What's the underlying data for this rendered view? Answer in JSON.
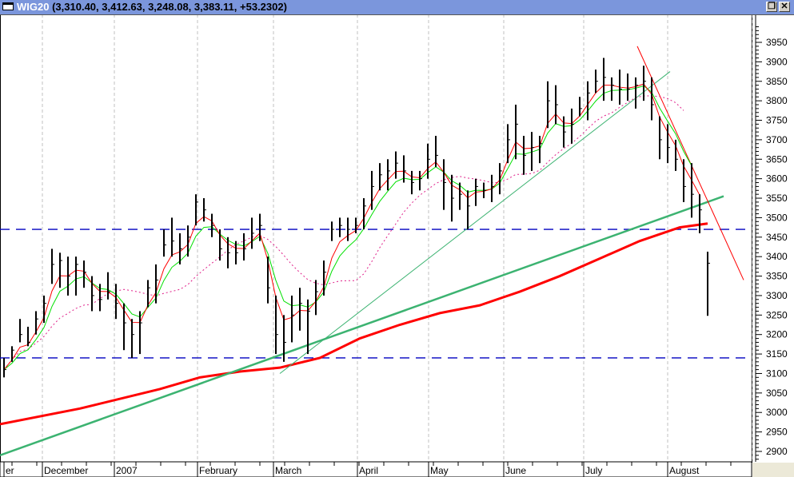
{
  "window": {
    "symbol": "WIG20",
    "values": "(3,310.40, 3,412.63, 3,248.08, 3,383.11, +53.2302)",
    "restore_icon": "restore-icon",
    "close_icon": "close-icon"
  },
  "chart_data": {
    "type": "ohlc-bar",
    "title": "WIG20",
    "ylim": [
      2880,
      3990
    ],
    "y_ticks": [
      2900,
      2950,
      3000,
      3050,
      3100,
      3150,
      3200,
      3250,
      3300,
      3350,
      3400,
      3450,
      3500,
      3550,
      3600,
      3650,
      3700,
      3750,
      3800,
      3850,
      3900,
      3950
    ],
    "x_labels": [
      {
        "label": "er",
        "bar": 0
      },
      {
        "label": "December",
        "bar": 4.8
      },
      {
        "label": "2007",
        "bar": 13.8
      },
      {
        "label": "February",
        "bar": 24.2
      },
      {
        "label": "March",
        "bar": 33.7
      },
      {
        "label": "April",
        "bar": 44.2
      },
      {
        "label": "May",
        "bar": 53.1
      },
      {
        "label": "June",
        "bar": 62.5
      },
      {
        "label": "July",
        "bar": 72.5
      },
      {
        "label": "August",
        "bar": 83
      }
    ],
    "bars": [
      [
        3140,
        3090,
        3110
      ],
      [
        3170,
        3130,
        3160
      ],
      [
        3240,
        3180,
        3200
      ],
      [
        3220,
        3170,
        3180
      ],
      [
        3260,
        3200,
        3240
      ],
      [
        3300,
        3230,
        3280
      ],
      [
        3420,
        3330,
        3380
      ],
      [
        3410,
        3320,
        3390
      ],
      [
        3400,
        3300,
        3350
      ],
      [
        3400,
        3300,
        3380
      ],
      [
        3390,
        3320,
        3360
      ],
      [
        3350,
        3260,
        3300
      ],
      [
        3330,
        3260,
        3290
      ],
      [
        3360,
        3290,
        3310
      ],
      [
        3330,
        3240,
        3280
      ],
      [
        3280,
        3160,
        3230
      ],
      [
        3240,
        3140,
        3200
      ],
      [
        3260,
        3150,
        3230
      ],
      [
        3340,
        3270,
        3320
      ],
      [
        3380,
        3280,
        3340
      ],
      [
        3470,
        3400,
        3430
      ],
      [
        3500,
        3400,
        3440
      ],
      [
        3460,
        3380,
        3420
      ],
      [
        3480,
        3400,
        3450
      ],
      [
        3560,
        3480,
        3540
      ],
      [
        3550,
        3490,
        3520
      ],
      [
        3510,
        3450,
        3480
      ],
      [
        3470,
        3390,
        3420
      ],
      [
        3450,
        3370,
        3410
      ],
      [
        3440,
        3380,
        3410
      ],
      [
        3460,
        3390,
        3420
      ],
      [
        3500,
        3420,
        3460
      ],
      [
        3510,
        3440,
        3480
      ],
      [
        3400,
        3280,
        3320
      ],
      [
        3300,
        3150,
        3200
      ],
      [
        3250,
        3130,
        3180
      ],
      [
        3300,
        3180,
        3250
      ],
      [
        3320,
        3210,
        3280
      ],
      [
        3290,
        3150,
        3260
      ],
      [
        3340,
        3250,
        3310
      ],
      [
        3390,
        3300,
        3360
      ],
      [
        3490,
        3440,
        3470
      ],
      [
        3500,
        3450,
        3480
      ],
      [
        3500,
        3440,
        3470
      ],
      [
        3500,
        3460,
        3480
      ],
      [
        3550,
        3470,
        3530
      ],
      [
        3620,
        3520,
        3580
      ],
      [
        3640,
        3570,
        3610
      ],
      [
        3650,
        3570,
        3620
      ],
      [
        3670,
        3600,
        3640
      ],
      [
        3660,
        3590,
        3620
      ],
      [
        3620,
        3560,
        3590
      ],
      [
        3620,
        3570,
        3600
      ],
      [
        3690,
        3600,
        3650
      ],
      [
        3710,
        3630,
        3660
      ],
      [
        3650,
        3520,
        3590
      ],
      [
        3610,
        3490,
        3550
      ],
      [
        3590,
        3520,
        3560
      ],
      [
        3570,
        3470,
        3530
      ],
      [
        3600,
        3530,
        3580
      ],
      [
        3590,
        3550,
        3570
      ],
      [
        3610,
        3540,
        3580
      ],
      [
        3640,
        3560,
        3620
      ],
      [
        3740,
        3640,
        3700
      ],
      [
        3790,
        3650,
        3740
      ],
      [
        3710,
        3610,
        3660
      ],
      [
        3720,
        3620,
        3680
      ],
      [
        3710,
        3640,
        3690
      ],
      [
        3850,
        3730,
        3800
      ],
      [
        3840,
        3740,
        3790
      ],
      [
        3760,
        3680,
        3720
      ],
      [
        3780,
        3690,
        3740
      ],
      [
        3810,
        3760,
        3780
      ],
      [
        3850,
        3750,
        3820
      ],
      [
        3880,
        3820,
        3850
      ],
      [
        3910,
        3800,
        3860
      ],
      [
        3860,
        3800,
        3840
      ],
      [
        3880,
        3790,
        3830
      ],
      [
        3870,
        3800,
        3830
      ],
      [
        3860,
        3780,
        3840
      ],
      [
        3890,
        3800,
        3850
      ],
      [
        3860,
        3750,
        3790
      ],
      [
        3760,
        3650,
        3700
      ],
      [
        3740,
        3640,
        3680
      ],
      [
        3700,
        3620,
        3650
      ],
      [
        3650,
        3540,
        3580
      ],
      [
        3640,
        3500,
        3560
      ],
      [
        3560,
        3460,
        3520
      ],
      [
        3412.63,
        3248.08,
        3383.11
      ]
    ],
    "bar_fields": [
      "high",
      "low",
      "close"
    ],
    "long_ma": [
      [
        -0.5,
        2970
      ],
      [
        9.5,
        3010
      ],
      [
        19.5,
        3060
      ],
      [
        24.5,
        3090
      ],
      [
        29.5,
        3105
      ],
      [
        34.5,
        3115
      ],
      [
        39.5,
        3140
      ],
      [
        44.5,
        3190
      ],
      [
        49.5,
        3225
      ],
      [
        54.5,
        3255
      ],
      [
        59.5,
        3275
      ],
      [
        64.5,
        3310
      ],
      [
        69.5,
        3350
      ],
      [
        74.5,
        3395
      ],
      [
        79.5,
        3440
      ],
      [
        84.5,
        3475
      ],
      [
        88,
        3485
      ]
    ],
    "ma_periods": {
      "red_thin": 3,
      "green": 5,
      "pink_dotted": 12
    },
    "horizontal_levels": [
      3470,
      3140
    ],
    "trendlines": [
      {
        "name": "long-support",
        "from": [
          -0.5,
          2890
        ],
        "to": [
          90,
          3555
        ],
        "color": "#3cb371",
        "weight": "thick"
      },
      {
        "name": "uptrend",
        "from": [
          34.5,
          3100
        ],
        "to": [
          83.3,
          3875
        ],
        "color": "#3cb371",
        "weight": "thin"
      },
      {
        "name": "downtrend",
        "from": [
          79.2,
          3940
        ],
        "to": [
          92.5,
          3340
        ],
        "color": "#ff0000",
        "weight": "thin"
      }
    ],
    "colors": {
      "bars": "#000000",
      "short_ma": "#ff0000",
      "mid_ma": "#00e000",
      "long_dotted": "#e0208a",
      "long_ma": "#ff0000",
      "levels": "#0000c0",
      "grid": "#c0c0c0"
    }
  }
}
